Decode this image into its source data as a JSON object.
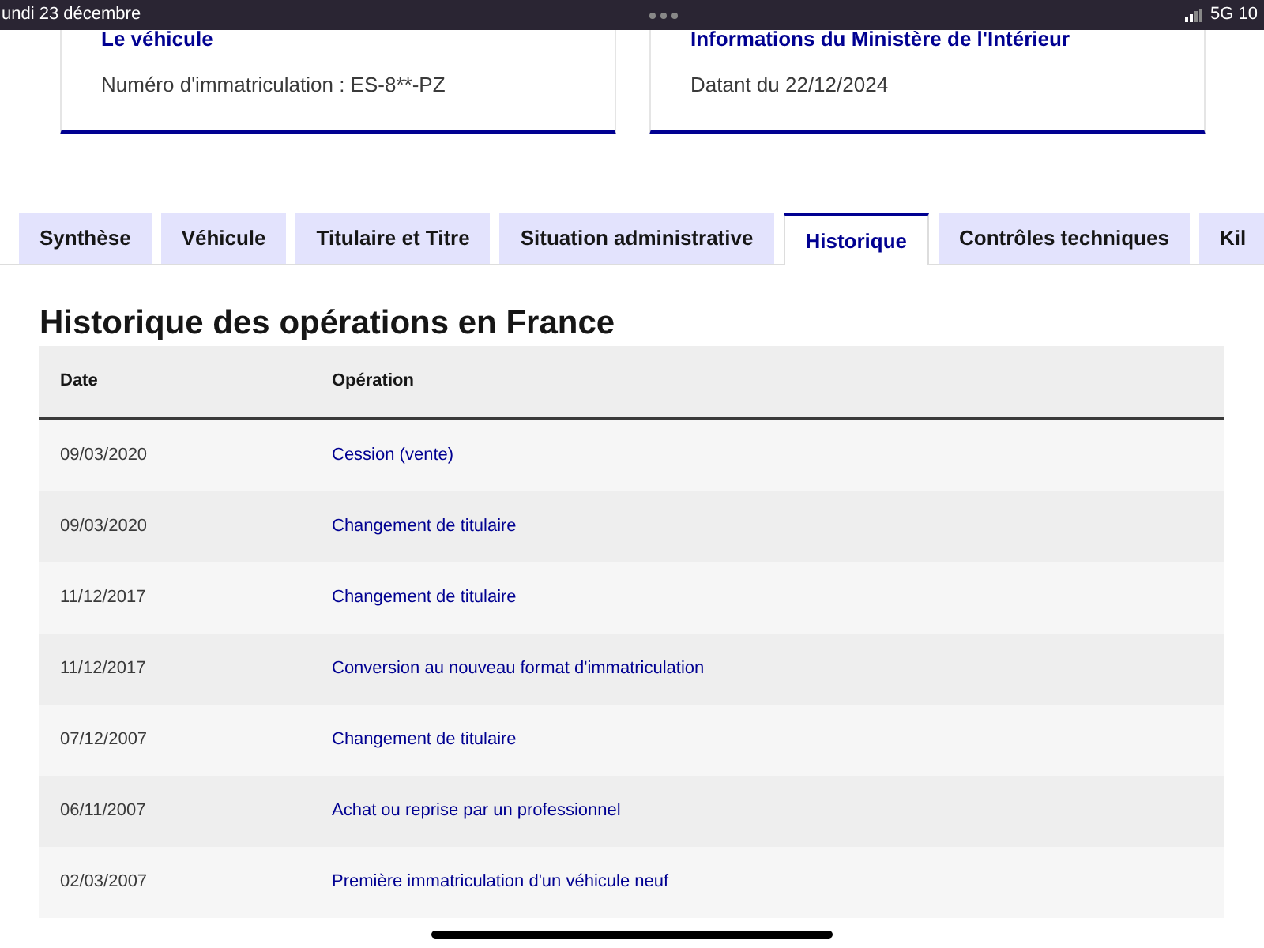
{
  "status_bar": {
    "date": "undi 23 décembre",
    "network": "5G 10"
  },
  "cards": [
    {
      "title": "Le véhicule",
      "text": "Numéro d'immatriculation : ES-8**-PZ"
    },
    {
      "title": "Informations du Ministère de l'Intérieur",
      "text": "Datant du 22/12/2024"
    }
  ],
  "tabs": [
    {
      "label": "Synthèse",
      "selected": false
    },
    {
      "label": "Véhicule",
      "selected": false
    },
    {
      "label": "Titulaire et Titre",
      "selected": false
    },
    {
      "label": "Situation administrative",
      "selected": false
    },
    {
      "label": "Historique",
      "selected": true
    },
    {
      "label": "Contrôles techniques",
      "selected": false
    },
    {
      "label": "Kil",
      "selected": false
    }
  ],
  "section": {
    "title": "Historique des opérations en France"
  },
  "table": {
    "columns": [
      "Date",
      "Opération"
    ],
    "rows": [
      [
        "09/03/2020",
        "Cession (vente)"
      ],
      [
        "09/03/2020",
        "Changement de titulaire"
      ],
      [
        "11/12/2017",
        "Changement de titulaire"
      ],
      [
        "11/12/2017",
        "Conversion au nouveau format d'immatriculation"
      ],
      [
        "07/12/2007",
        "Changement de titulaire"
      ],
      [
        "06/11/2007",
        "Achat ou reprise par un professionnel"
      ],
      [
        "02/03/2007",
        "Première immatriculation d'un véhicule neuf"
      ]
    ]
  }
}
